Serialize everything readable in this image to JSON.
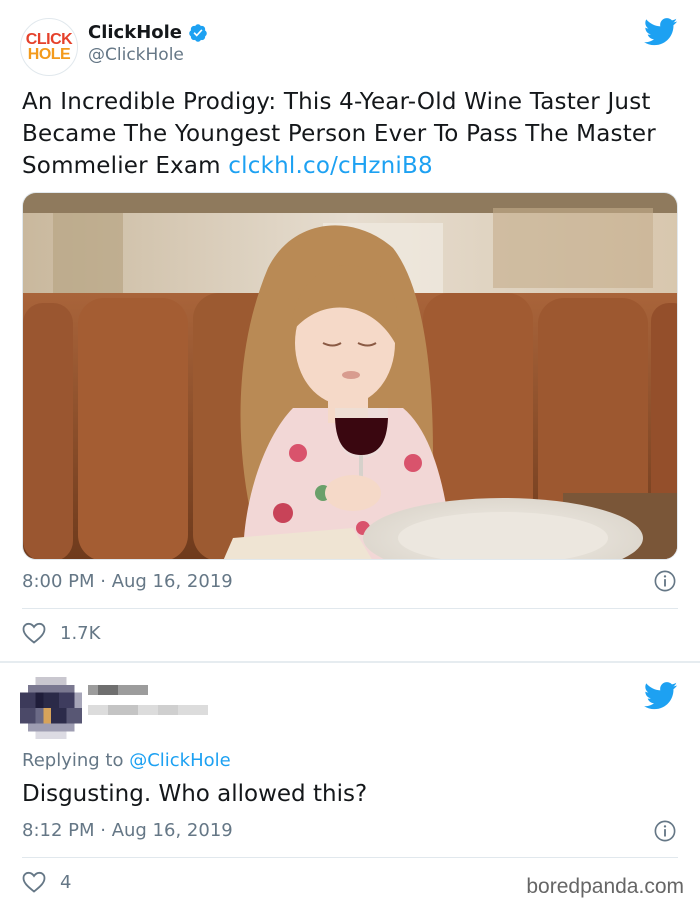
{
  "tweet": {
    "display_name": "ClickHole",
    "handle": "@ClickHole",
    "logo_line1": "CLICK",
    "logo_line2": "HOLE",
    "text": "An Incredible Prodigy: This 4-Year-Old Wine Taster Just Became The Youngest Person Ever To Pass The Master Sommelier Exam ",
    "link": "clckhl.co/cHzniB8",
    "timestamp": "8:00 PM · Aug 16, 2019",
    "likes": "1.7K",
    "verified_icon": "verified-badge-icon",
    "platform_icon": "twitter-bird-icon"
  },
  "reply": {
    "replying_prefix": "Replying to ",
    "replying_mention": "@ClickHole",
    "text": "Disgusting. Who allowed this?",
    "timestamp": "8:12 PM · Aug 16, 2019",
    "likes": "4"
  },
  "watermark": "boredpanda.com",
  "colors": {
    "twitter_blue": "#1da1f2",
    "muted": "#657786",
    "brand_red": "#e5412b",
    "brand_orange": "#f39a1c"
  }
}
